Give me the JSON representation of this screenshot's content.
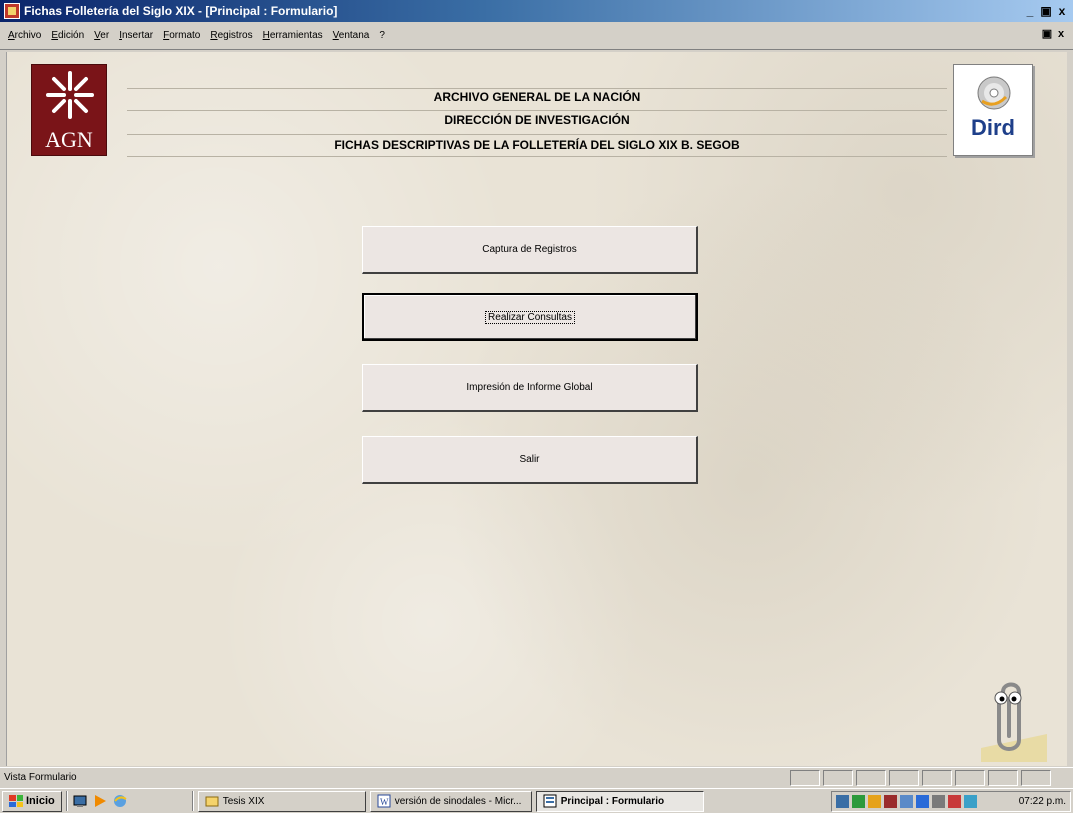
{
  "window": {
    "title": "Fichas Folletería del Siglo XIX - [Principal : Formulario]",
    "controls": {
      "minimize": "_",
      "maximize": "\u0018",
      "close": "x"
    }
  },
  "menu": {
    "items": [
      "Archivo",
      "Edición",
      "Ver",
      "Insertar",
      "Formato",
      "Registros",
      "Herramientas",
      "Ventana",
      "?"
    ]
  },
  "header": {
    "line1": "ARCHIVO GENERAL DE LA NACIÓN",
    "line2": "DIRECCIÓN DE INVESTIGACIÓN",
    "line3": "FICHAS DESCRIPTIVAS DE LA FOLLETERÍA DEL SIGLO XIX B. SEGOB",
    "logo_left": "AGN",
    "logo_right": "Dird"
  },
  "buttons": {
    "capture": "Captura de Registros",
    "query": "Realizar Consultas",
    "print": "Impresión de Informe Global",
    "exit": "Salir"
  },
  "status": {
    "text": "Vista Formulario"
  },
  "taskbar": {
    "start": "Inicio",
    "tasks": [
      "Tesis XIX",
      "versión de sinodales - Micr...",
      "Principal : Formulario"
    ],
    "clock": "07:22 p.m."
  },
  "colors": {
    "titlebar_start": "#0a246a",
    "titlebar_end": "#a6caf0",
    "agn_red": "#7a1418",
    "dird_blue": "#1e3f8a",
    "form_bg": "#e9e3d6",
    "button_bg": "#ece6e3"
  }
}
